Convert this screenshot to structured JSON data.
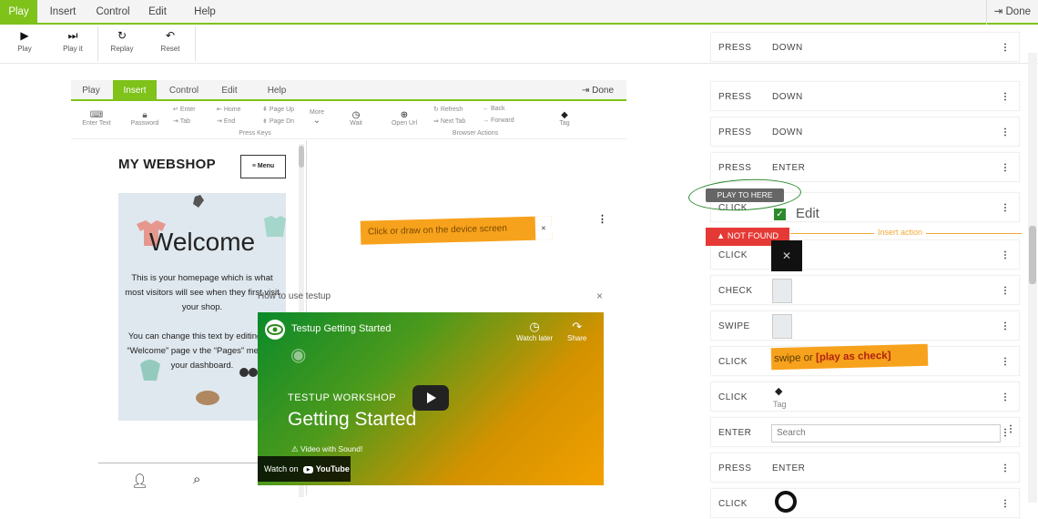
{
  "top_menu": {
    "tabs": [
      "Play",
      "Insert",
      "Control",
      "Edit",
      "Help"
    ],
    "active_tab": "Play",
    "done_label": "Done"
  },
  "toolbar": {
    "play_label": "Play",
    "play_it_label": "Play it",
    "replay_label": "Replay",
    "reset_label": "Reset"
  },
  "inner_app": {
    "tabs": [
      "Play",
      "Insert",
      "Control",
      "Edit",
      "Help"
    ],
    "active_tab": "Insert",
    "done_label": "Done",
    "toolbar": {
      "enter_text": "Enter Text",
      "password": "Password",
      "enter": "Enter",
      "home": "Home",
      "page_up": "Page Up",
      "tab": "Tab",
      "end": "End",
      "page_dn": "Page Dn",
      "press_keys": "Press Keys",
      "more": "More",
      "wait": "Wait",
      "open_url": "Open Url",
      "refresh": "Refresh",
      "back": "Back",
      "next_tab": "Next Tab",
      "forward": "Forward",
      "browser_actions": "Browser Actions",
      "tag": "Tag"
    },
    "phone": {
      "shop_title": "MY WEBSHOP",
      "menu_label": "Menu",
      "welcome_title": "Welcome",
      "paragraph_1": "This is your homepage which is what most visitors will see when they first visit your shop.",
      "paragraph_2": "You can change this text by editing the “Welcome” page v the “Pages” menu in your dashboard."
    },
    "click_tip": "Click or draw on the device screen",
    "click_tip_close": "×"
  },
  "video": {
    "header": "How to use testup",
    "close": "×",
    "title": "Testup Getting Started",
    "watch_later": "Watch later",
    "share": "Share",
    "workshop": "TESTUP WORKSHOP",
    "getting_started": "Getting Started",
    "sound_note": "Video with Sound!",
    "watch_on": "Watch on",
    "youtube": "YouTube"
  },
  "steps": [
    {
      "action": "PRESS",
      "value": "DOWN"
    },
    {
      "action": "PRESS",
      "value": "DOWN"
    },
    {
      "action": "PRESS",
      "value": "DOWN"
    },
    {
      "action": "PRESS",
      "value": "ENTER"
    },
    {
      "action": "CLICK",
      "value": ""
    },
    {
      "action": "CLICK",
      "value": ""
    },
    {
      "action": "CHECK",
      "value": ""
    },
    {
      "action": "SWIPE",
      "value": ""
    },
    {
      "action": "CLICK",
      "value": ""
    },
    {
      "action": "CLICK",
      "value": ""
    },
    {
      "action": "ENTER",
      "value": ""
    },
    {
      "action": "PRESS",
      "value": "ENTER"
    },
    {
      "action": "CLICK",
      "value": ""
    }
  ],
  "annotations": {
    "play_to_here": "PLAY TO HERE",
    "not_found": "NOT FOUND",
    "edit": "Edit",
    "insert_action": "Insert action",
    "swipe_hint_plain": "swipe or ",
    "swipe_hint_bold": "[play as check]",
    "tag_label": "Tag",
    "search_placeholder": "Search"
  },
  "colors": {
    "accent_green": "#7ec21a",
    "tip_orange": "#f7a21c",
    "error_red": "#e53935",
    "circle_green": "#2c8a2c"
  }
}
